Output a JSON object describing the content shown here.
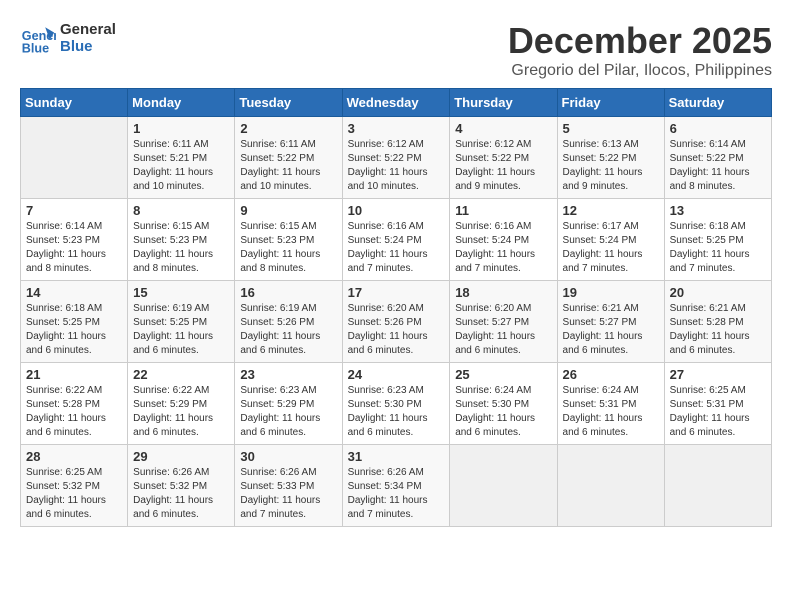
{
  "logo": {
    "line1": "General",
    "line2": "Blue"
  },
  "title": "December 2025",
  "location": "Gregorio del Pilar, Ilocos, Philippines",
  "weekdays": [
    "Sunday",
    "Monday",
    "Tuesday",
    "Wednesday",
    "Thursday",
    "Friday",
    "Saturday"
  ],
  "weeks": [
    [
      {
        "day": "",
        "sunrise": "",
        "sunset": "",
        "daylight": ""
      },
      {
        "day": "1",
        "sunrise": "6:11 AM",
        "sunset": "5:21 PM",
        "daylight": "11 hours and 10 minutes."
      },
      {
        "day": "2",
        "sunrise": "6:11 AM",
        "sunset": "5:22 PM",
        "daylight": "11 hours and 10 minutes."
      },
      {
        "day": "3",
        "sunrise": "6:12 AM",
        "sunset": "5:22 PM",
        "daylight": "11 hours and 10 minutes."
      },
      {
        "day": "4",
        "sunrise": "6:12 AM",
        "sunset": "5:22 PM",
        "daylight": "11 hours and 9 minutes."
      },
      {
        "day": "5",
        "sunrise": "6:13 AM",
        "sunset": "5:22 PM",
        "daylight": "11 hours and 9 minutes."
      },
      {
        "day": "6",
        "sunrise": "6:14 AM",
        "sunset": "5:22 PM",
        "daylight": "11 hours and 8 minutes."
      }
    ],
    [
      {
        "day": "7",
        "sunrise": "6:14 AM",
        "sunset": "5:23 PM",
        "daylight": "11 hours and 8 minutes."
      },
      {
        "day": "8",
        "sunrise": "6:15 AM",
        "sunset": "5:23 PM",
        "daylight": "11 hours and 8 minutes."
      },
      {
        "day": "9",
        "sunrise": "6:15 AM",
        "sunset": "5:23 PM",
        "daylight": "11 hours and 8 minutes."
      },
      {
        "day": "10",
        "sunrise": "6:16 AM",
        "sunset": "5:24 PM",
        "daylight": "11 hours and 7 minutes."
      },
      {
        "day": "11",
        "sunrise": "6:16 AM",
        "sunset": "5:24 PM",
        "daylight": "11 hours and 7 minutes."
      },
      {
        "day": "12",
        "sunrise": "6:17 AM",
        "sunset": "5:24 PM",
        "daylight": "11 hours and 7 minutes."
      },
      {
        "day": "13",
        "sunrise": "6:18 AM",
        "sunset": "5:25 PM",
        "daylight": "11 hours and 7 minutes."
      }
    ],
    [
      {
        "day": "14",
        "sunrise": "6:18 AM",
        "sunset": "5:25 PM",
        "daylight": "11 hours and 6 minutes."
      },
      {
        "day": "15",
        "sunrise": "6:19 AM",
        "sunset": "5:25 PM",
        "daylight": "11 hours and 6 minutes."
      },
      {
        "day": "16",
        "sunrise": "6:19 AM",
        "sunset": "5:26 PM",
        "daylight": "11 hours and 6 minutes."
      },
      {
        "day": "17",
        "sunrise": "6:20 AM",
        "sunset": "5:26 PM",
        "daylight": "11 hours and 6 minutes."
      },
      {
        "day": "18",
        "sunrise": "6:20 AM",
        "sunset": "5:27 PM",
        "daylight": "11 hours and 6 minutes."
      },
      {
        "day": "19",
        "sunrise": "6:21 AM",
        "sunset": "5:27 PM",
        "daylight": "11 hours and 6 minutes."
      },
      {
        "day": "20",
        "sunrise": "6:21 AM",
        "sunset": "5:28 PM",
        "daylight": "11 hours and 6 minutes."
      }
    ],
    [
      {
        "day": "21",
        "sunrise": "6:22 AM",
        "sunset": "5:28 PM",
        "daylight": "11 hours and 6 minutes."
      },
      {
        "day": "22",
        "sunrise": "6:22 AM",
        "sunset": "5:29 PM",
        "daylight": "11 hours and 6 minutes."
      },
      {
        "day": "23",
        "sunrise": "6:23 AM",
        "sunset": "5:29 PM",
        "daylight": "11 hours and 6 minutes."
      },
      {
        "day": "24",
        "sunrise": "6:23 AM",
        "sunset": "5:30 PM",
        "daylight": "11 hours and 6 minutes."
      },
      {
        "day": "25",
        "sunrise": "6:24 AM",
        "sunset": "5:30 PM",
        "daylight": "11 hours and 6 minutes."
      },
      {
        "day": "26",
        "sunrise": "6:24 AM",
        "sunset": "5:31 PM",
        "daylight": "11 hours and 6 minutes."
      },
      {
        "day": "27",
        "sunrise": "6:25 AM",
        "sunset": "5:31 PM",
        "daylight": "11 hours and 6 minutes."
      }
    ],
    [
      {
        "day": "28",
        "sunrise": "6:25 AM",
        "sunset": "5:32 PM",
        "daylight": "11 hours and 6 minutes."
      },
      {
        "day": "29",
        "sunrise": "6:26 AM",
        "sunset": "5:32 PM",
        "daylight": "11 hours and 6 minutes."
      },
      {
        "day": "30",
        "sunrise": "6:26 AM",
        "sunset": "5:33 PM",
        "daylight": "11 hours and 7 minutes."
      },
      {
        "day": "31",
        "sunrise": "6:26 AM",
        "sunset": "5:34 PM",
        "daylight": "11 hours and 7 minutes."
      },
      {
        "day": "",
        "sunrise": "",
        "sunset": "",
        "daylight": ""
      },
      {
        "day": "",
        "sunrise": "",
        "sunset": "",
        "daylight": ""
      },
      {
        "day": "",
        "sunrise": "",
        "sunset": "",
        "daylight": ""
      }
    ]
  ]
}
